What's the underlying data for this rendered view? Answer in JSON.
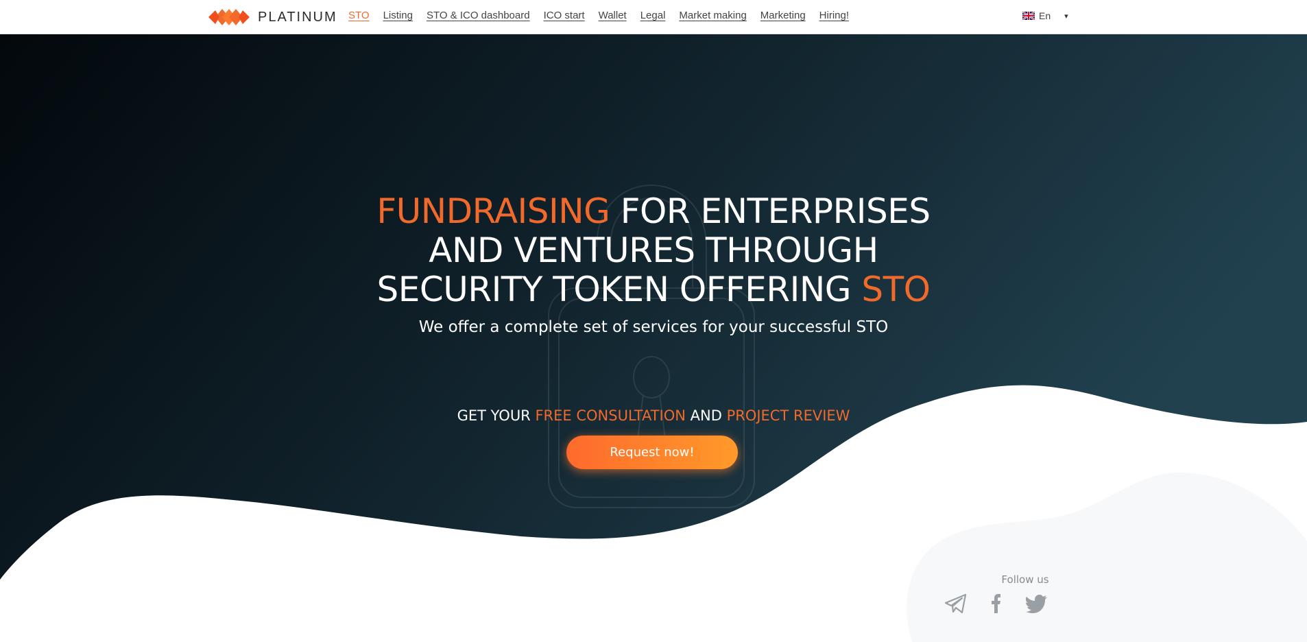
{
  "brand": {
    "name": "PLATINUM",
    "logo_icon": "diamond-logo-icon",
    "accent_color": "#f26a2b"
  },
  "nav": {
    "items": [
      {
        "label": "STO",
        "active": true
      },
      {
        "label": "Listing"
      },
      {
        "label": "STO & ICO dashboard"
      },
      {
        "label": "ICO start"
      },
      {
        "label": "Wallet"
      },
      {
        "label": "Legal"
      },
      {
        "label": "Market making"
      },
      {
        "label": "Marketing"
      },
      {
        "label": "Hiring!"
      }
    ]
  },
  "language": {
    "selected": "En",
    "flag_icon": "uk-flag-icon",
    "caret": "▾"
  },
  "hero": {
    "title_highlight_1": "FUNDRAISING",
    "title_part_1": " FOR ENTERPRISES",
    "title_part_2": "AND VENTURES THROUGH",
    "title_part_3": "SECURITY TOKEN OFFERING ",
    "title_highlight_2": "STO",
    "subtitle": "We offer a complete set of services for your successful STO",
    "cta_part_1": "GET YOUR ",
    "cta_highlight_1": "FREE CONSULTATION",
    "cta_part_2": " AND ",
    "cta_highlight_2": "PROJECT REVIEW",
    "button_label": "Request now!"
  },
  "social": {
    "label": "Follow us",
    "icons": [
      "telegram-icon",
      "facebook-icon",
      "twitter-icon"
    ]
  },
  "colors": {
    "hero_dark": "#050b10",
    "hero_teal": "#1f3e4c",
    "button_start": "#ff6a2c",
    "button_end": "#ff9a2a"
  }
}
